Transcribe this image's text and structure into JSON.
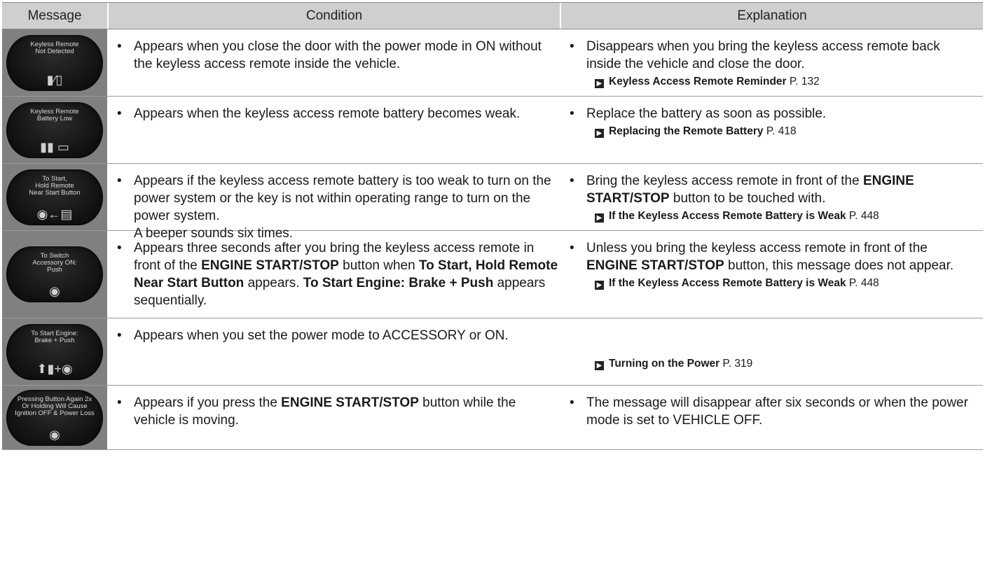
{
  "header": {
    "message": "Message",
    "condition": "Condition",
    "explanation": "Explanation"
  },
  "rows": [
    {
      "screen_text": "Keyless Remote\nNot Detected",
      "screen_icon": "remote-missing-icon",
      "condition": [
        {
          "t": "Appears when you close the door with the power mode in ON without the keyless access remote inside the vehicle."
        }
      ],
      "explanation": [
        {
          "t": "Disappears when you bring the keyless access remote back inside the vehicle and close the door."
        }
      ],
      "ref": {
        "title": "Keyless Access Remote Reminder",
        "page": "P. 132"
      }
    },
    {
      "screen_text": "Keyless Remote\nBattery Low",
      "screen_icon": "battery-low-icon",
      "condition": [
        {
          "t": "Appears when the keyless access remote battery becomes weak."
        }
      ],
      "explanation": [
        {
          "t": "Replace the battery as soon as possible."
        }
      ],
      "ref": {
        "title": "Replacing the Remote Battery",
        "page": "P. 418"
      }
    },
    {
      "screen_text": "To Start,\nHold Remote\nNear Start Button",
      "screen_icon": "remote-to-button-icon",
      "condition": [
        {
          "t": "Appears if the keyless access remote battery is too weak to turn on the power system or the key is not within operating range to turn on the power system."
        }
      ],
      "condition_extra": "A beeper sounds six times.",
      "explanation": [
        {
          "t": "Bring the keyless access remote in front of the "
        },
        {
          "t": "ENGINE START/STOP",
          "b": true
        },
        {
          "t": " button to be touched with."
        }
      ],
      "ref": {
        "title": "If the Keyless Access Remote Battery is Weak",
        "page": "P. 448"
      }
    },
    {
      "screen_text": "To Switch\nAccessory ON:\nPush",
      "screen_icon": "push-button-icon",
      "condition": [
        {
          "t": "Appears three seconds after you bring the keyless access remote in front of the "
        },
        {
          "t": "ENGINE START/STOP",
          "b": true
        },
        {
          "t": " button when "
        },
        {
          "t": "To Start, Hold Remote Near Start Button",
          "b": true
        },
        {
          "t": " appears. "
        },
        {
          "t": "To Start Engine: Brake + Push",
          "b": true
        },
        {
          "t": " appears sequentially."
        }
      ],
      "explanation": [
        {
          "t": "Unless you bring the keyless access remote in front of the "
        },
        {
          "t": "ENGINE START/STOP",
          "b": true
        },
        {
          "t": " button, this message does not appear."
        }
      ],
      "ref": {
        "title": "If the Keyless Access Remote Battery is Weak",
        "page": "P. 448"
      }
    },
    {
      "screen_text": "To Start Engine:\nBrake + Push",
      "screen_icon": "brake-push-icon",
      "condition": [
        {
          "t": "Appears when you set the power mode to ACCESSORY or ON."
        }
      ],
      "explanation": [],
      "ref": {
        "title": "Turning on the Power",
        "page": "P. 319"
      }
    },
    {
      "screen_text": "Pressing Button Again 2x\nOr Holding Will Cause\nIgnition OFF & Power Loss",
      "screen_icon": "push-button-icon",
      "condition": [
        {
          "t": "Appears if you press the "
        },
        {
          "t": "ENGINE START/STOP",
          "b": true
        },
        {
          "t": " button while the vehicle is moving."
        }
      ],
      "explanation": [
        {
          "t": "The message will disappear after six seconds or when the power mode is set to VEHICLE OFF."
        }
      ],
      "ref": null
    }
  ]
}
